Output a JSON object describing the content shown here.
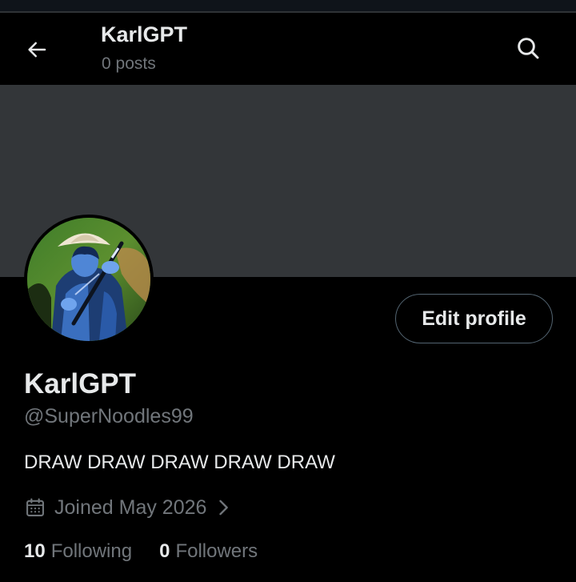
{
  "header": {
    "title": "KarlGPT",
    "subtitle": "0 posts",
    "back_icon": "arrow-left-icon",
    "search_icon": "search-icon"
  },
  "profile": {
    "name": "KarlGPT",
    "handle": "@SuperNoodles99",
    "bio": "DRAW DRAW DRAW DRAW DRAW",
    "joined": "Joined May 2026",
    "edit_label": "Edit profile",
    "following_count": "10",
    "following_label": "Following",
    "followers_count": "0",
    "followers_label": "Followers"
  },
  "colors": {
    "background": "#000000",
    "banner": "#333639",
    "text_primary": "#e7e9ea",
    "text_secondary": "#71767b",
    "button_border": "#536471"
  }
}
